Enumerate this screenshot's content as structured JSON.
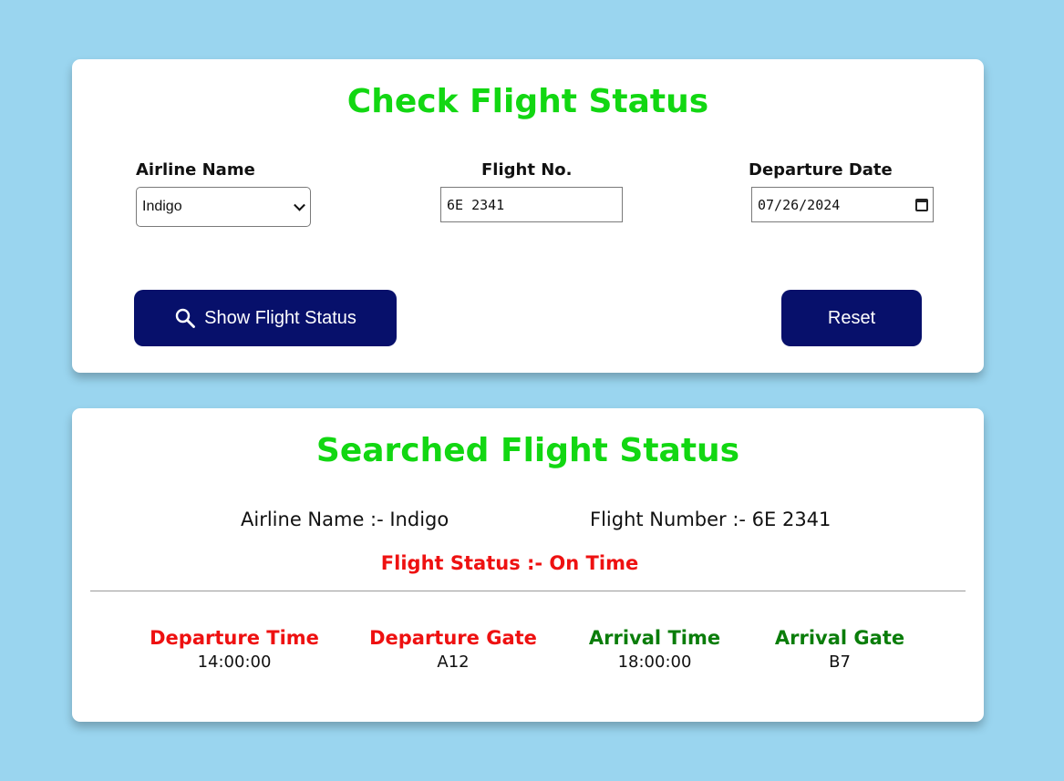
{
  "search": {
    "title": "Check Flight Status",
    "airline": {
      "label": "Airline Name",
      "value": "Indigo"
    },
    "flight": {
      "label": "Flight No.",
      "value": "6E 2341"
    },
    "date": {
      "label": "Departure Date",
      "value": "07/26/2024"
    },
    "show_button": "Show Flight Status",
    "reset_button": "Reset"
  },
  "result": {
    "title": "Searched Flight Status",
    "airline_text": "Airline Name :- Indigo",
    "flight_text": "Flight Number :- 6E 2341",
    "status_text": "Flight Status :- On Time",
    "columns": [
      {
        "label": "Departure Time",
        "value": "14:00:00",
        "color": "#ee1111"
      },
      {
        "label": "Departure Gate",
        "value": "A12",
        "color": "#ee1111"
      },
      {
        "label": "Arrival Time",
        "value": "18:00:00",
        "color": "#0a7d0a"
      },
      {
        "label": "Arrival Gate",
        "value": "B7",
        "color": "#0a7d0a"
      }
    ]
  },
  "colors": {
    "background": "#9ad5ef",
    "title": "#12d712",
    "button": "#07106b",
    "status": "#ee1111",
    "arrival": "#0a7d0a"
  },
  "icons": {
    "search": "search-icon",
    "dropdown": "chevron-down-icon",
    "calendar": "calendar-icon"
  }
}
